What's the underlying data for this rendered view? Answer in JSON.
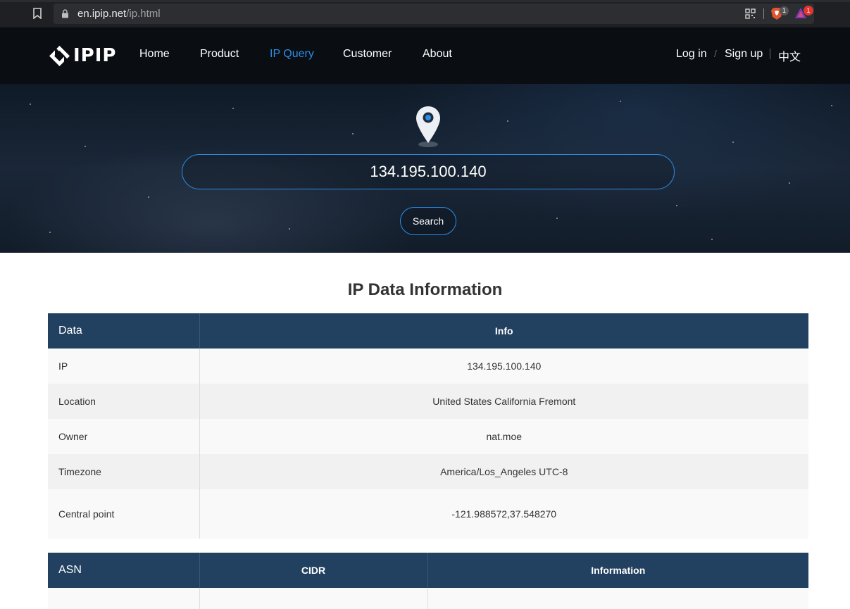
{
  "browser": {
    "url_host": "en.ipip.net",
    "url_path": "/ip.html",
    "brave_badge": "1",
    "rewards_badge": "1"
  },
  "header": {
    "logo_text": "IPIP",
    "nav": [
      "Home",
      "Product",
      "IP Query",
      "Customer",
      "About"
    ],
    "active_nav": "IP Query",
    "login": "Log in",
    "separator": "/",
    "signup": "Sign up",
    "language": "中文"
  },
  "search": {
    "value": "134.195.100.140",
    "button": "Search"
  },
  "main": {
    "title": "IP Data Information",
    "table": {
      "headers": [
        "Data",
        "Info"
      ],
      "rows": [
        {
          "label": "IP",
          "value": "134.195.100.140"
        },
        {
          "label": "Location",
          "value": "United States California Fremont"
        },
        {
          "label": "Owner",
          "value": "nat.moe"
        },
        {
          "label": "Timezone",
          "value": "America/Los_Angeles UTC-8"
        },
        {
          "label": "Central point",
          "value": "-121.988572,37.548270"
        }
      ]
    },
    "asn_table": {
      "headers": [
        "ASN",
        "CIDR",
        "Information"
      ]
    }
  },
  "colors": {
    "accent": "#2b8ee6",
    "table_header": "#22405f",
    "header_bg": "#0a0d12"
  }
}
